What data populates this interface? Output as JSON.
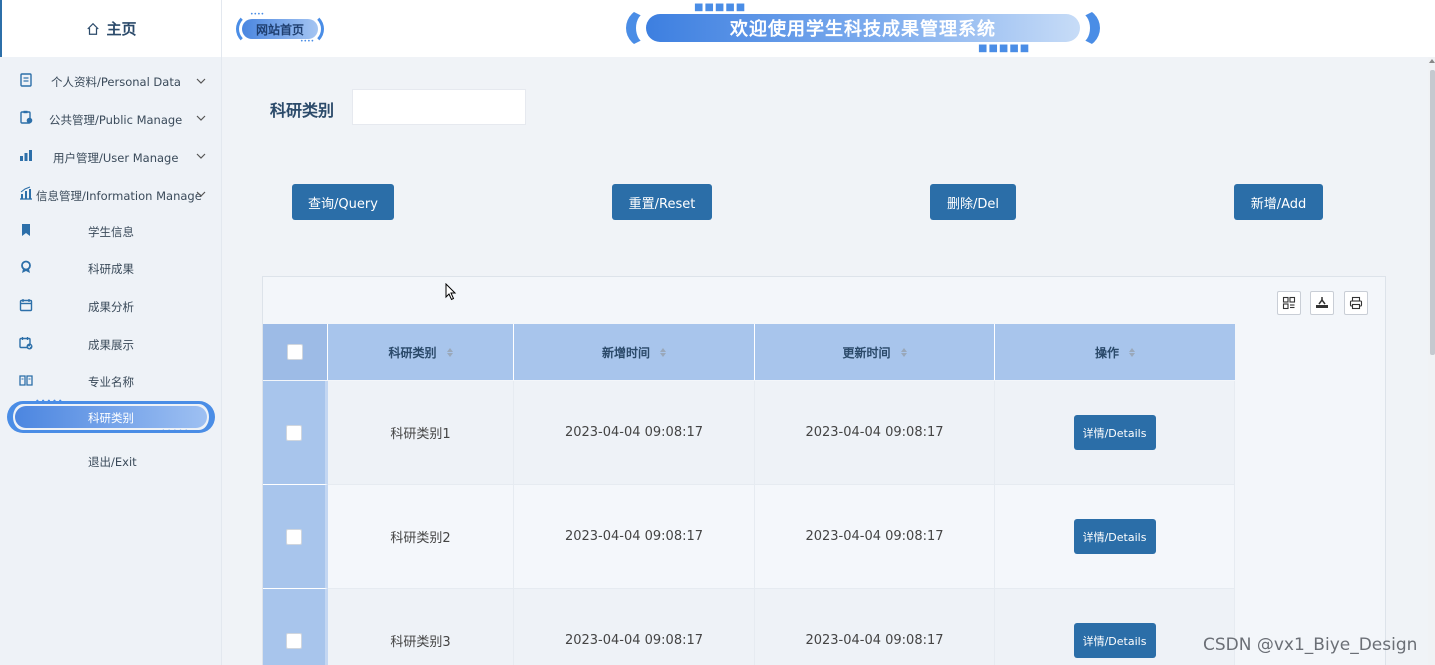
{
  "sidebar": {
    "home_label": "主页",
    "parents": [
      {
        "label": "个人资料/Personal Data",
        "icon": "profile-icon"
      },
      {
        "label": "公共管理/Public Manage",
        "icon": "clipboard-icon"
      },
      {
        "label": "用户管理/User Manage",
        "icon": "user-manage-icon"
      },
      {
        "label": "信息管理/Information Manage",
        "icon": "chart-icon"
      }
    ],
    "children": [
      {
        "label": "学生信息",
        "icon": "bookmark-icon"
      },
      {
        "label": "科研成果",
        "icon": "award-icon"
      },
      {
        "label": "成果分析",
        "icon": "calendar-icon"
      },
      {
        "label": "成果展示",
        "icon": "calendar-check-icon"
      },
      {
        "label": "专业名称",
        "icon": "book-icon"
      },
      {
        "label": "科研类别",
        "icon": "",
        "active": true
      },
      {
        "label": "退出/Exit",
        "icon": ""
      }
    ]
  },
  "header": {
    "site_home_label": "网站首页",
    "system_title": "欢迎使用学生科技成果管理系统"
  },
  "search": {
    "label": "科研类别",
    "value": "",
    "placeholder": ""
  },
  "actions": {
    "query": "查询/Query",
    "reset": "重置/Reset",
    "delete": "删除/Del",
    "add": "新增/Add"
  },
  "table": {
    "columns": [
      "科研类别",
      "新增时间",
      "更新时间",
      "操作"
    ],
    "rows": [
      {
        "category": "科研类别1",
        "created": "2023-04-04 09:08:17",
        "updated": "2023-04-04 09:08:17",
        "action": "详情/Details"
      },
      {
        "category": "科研类别2",
        "created": "2023-04-04 09:08:17",
        "updated": "2023-04-04 09:08:17",
        "action": "详情/Details"
      },
      {
        "category": "科研类别3",
        "created": "2023-04-04 09:08:17",
        "updated": "2023-04-04 09:08:17",
        "action": "详情/Details"
      }
    ]
  },
  "watermark": "CSDN @vx1_Biye_Design",
  "colors": {
    "primary_button": "#2b6ea8",
    "header_cell": "#a8c5ec",
    "accent_blue": "#4a8de6"
  }
}
